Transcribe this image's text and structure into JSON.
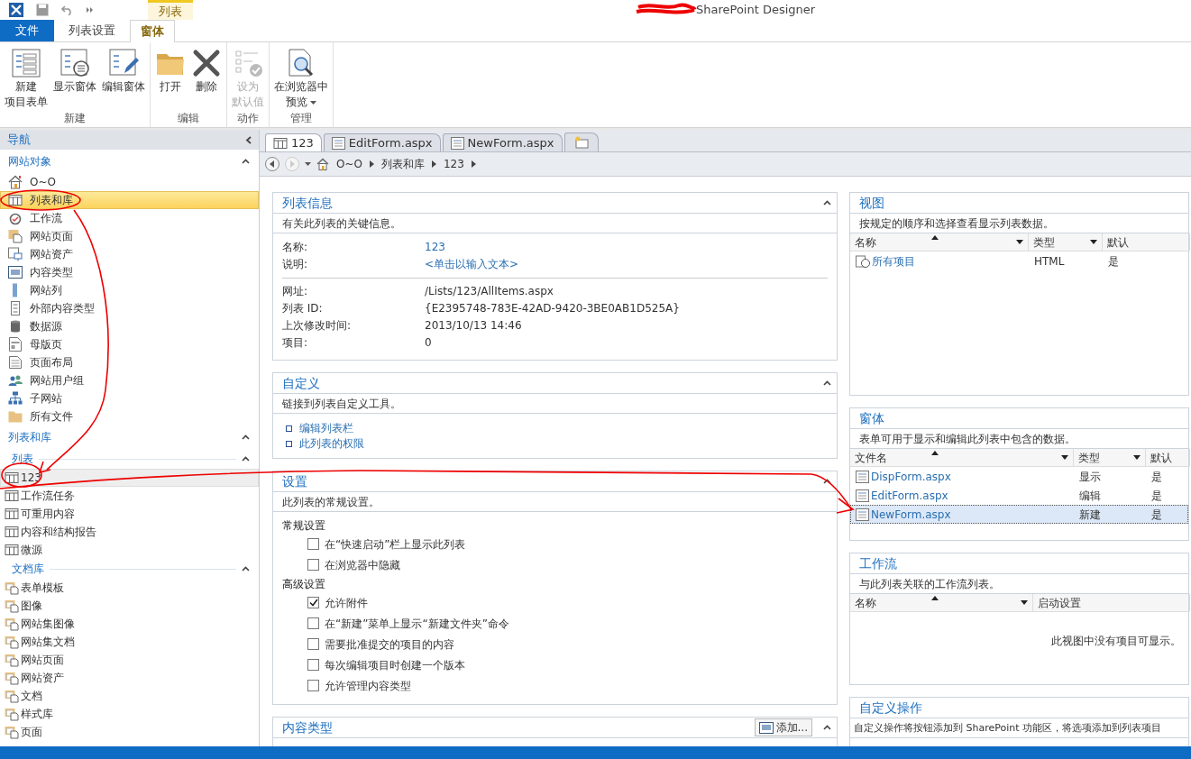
{
  "window": {
    "title": "SharePoint Designer"
  },
  "ribbon": {
    "contextual_label": "列表",
    "tabs": [
      {
        "label": "文件",
        "kind": "file",
        "selected": false
      },
      {
        "label": "列表设置",
        "kind": "normal",
        "selected": false
      },
      {
        "label": "窗体",
        "kind": "contextual",
        "selected": true
      }
    ],
    "groups": [
      {
        "label": "新建",
        "buttons": [
          {
            "lines": [
              "新建",
              "项目表单"
            ],
            "disabled": false
          },
          {
            "lines": [
              "显示窗体"
            ],
            "disabled": false
          },
          {
            "lines": [
              "编辑窗体"
            ],
            "disabled": false
          }
        ]
      },
      {
        "label": "编辑",
        "buttons": [
          {
            "lines": [
              "打开"
            ],
            "disabled": false
          },
          {
            "lines": [
              "删除"
            ],
            "disabled": false
          }
        ]
      },
      {
        "label": "动作",
        "buttons": [
          {
            "lines": [
              "设为",
              "默认值"
            ],
            "disabled": true
          }
        ]
      },
      {
        "label": "管理",
        "buttons": [
          {
            "lines": [
              "在浏览器中",
              "预览"
            ],
            "disabled": false,
            "dropdown": true
          }
        ]
      }
    ]
  },
  "navigation": {
    "title": "导航",
    "site_objects": {
      "title": "网站对象",
      "expanded": true,
      "items": [
        {
          "label": "O~O",
          "selected": false
        },
        {
          "label": "列表和库",
          "selected": true
        },
        {
          "label": "工作流",
          "selected": false
        },
        {
          "label": "网站页面",
          "selected": false
        },
        {
          "label": "网站资产",
          "selected": false
        },
        {
          "label": "内容类型",
          "selected": false
        },
        {
          "label": "网站列",
          "selected": false
        },
        {
          "label": "外部内容类型",
          "selected": false
        },
        {
          "label": "数据源",
          "selected": false
        },
        {
          "label": "母版页",
          "selected": false
        },
        {
          "label": "页面布局",
          "selected": false
        },
        {
          "label": "网站用户组",
          "selected": false
        },
        {
          "label": "子网站",
          "selected": false
        },
        {
          "label": "所有文件",
          "selected": false
        }
      ]
    },
    "lists_and_libraries": {
      "title": "列表和库",
      "expanded": true,
      "groups": [
        {
          "title": "列表",
          "kind": "list",
          "expanded": true,
          "items": [
            {
              "label": "123",
              "selected": true
            },
            {
              "label": "工作流任务",
              "selected": false
            },
            {
              "label": "可重用内容",
              "selected": false
            },
            {
              "label": "内容和结构报告",
              "selected": false
            },
            {
              "label": "微源",
              "selected": false
            }
          ]
        },
        {
          "title": "文档库",
          "kind": "library",
          "expanded": true,
          "items": [
            {
              "label": "表单模板",
              "selected": false
            },
            {
              "label": "图像",
              "selected": false
            },
            {
              "label": "网站集图像",
              "selected": false
            },
            {
              "label": "网站集文档",
              "selected": false
            },
            {
              "label": "网站页面",
              "selected": false
            },
            {
              "label": "网站资产",
              "selected": false
            },
            {
              "label": "文档",
              "selected": false
            },
            {
              "label": "样式库",
              "selected": false
            },
            {
              "label": "页面",
              "selected": false
            }
          ]
        }
      ]
    }
  },
  "document_tabs": [
    {
      "label": "123",
      "kind": "list",
      "selected": true
    },
    {
      "label": "EditForm.aspx",
      "kind": "form",
      "selected": false
    },
    {
      "label": "NewForm.aspx",
      "kind": "form",
      "selected": false
    }
  ],
  "breadcrumb": [
    "O~O",
    "列表和库",
    "123"
  ],
  "list_info": {
    "title": "列表信息",
    "expanded": true,
    "description": "有关此列表的关键信息。",
    "field_groups": [
      [
        {
          "label": "名称:",
          "value": "123",
          "kind": "link"
        },
        {
          "label": "说明:",
          "value": "<单击以输入文本>",
          "kind": "link"
        }
      ],
      [
        {
          "label": "网址:",
          "value": "/Lists/123/AllItems.aspx",
          "kind": "plain"
        },
        {
          "label": "列表 ID:",
          "value": "{E2395748-783E-42AD-9420-3BE0AB1D525A}",
          "kind": "plain"
        },
        {
          "label": "上次修改时间:",
          "value": "2013/10/13 14:46",
          "kind": "plain"
        },
        {
          "label": "项目:",
          "value": "0",
          "kind": "plain"
        }
      ]
    ]
  },
  "customization": {
    "title": "自定义",
    "expanded": true,
    "description": "链接到列表自定义工具。",
    "links": [
      "编辑列表栏",
      "此列表的权限"
    ]
  },
  "settings": {
    "title": "设置",
    "expanded": true,
    "description": "此列表的常规设置。",
    "groups": [
      {
        "title": "常规设置",
        "options": [
          {
            "label": "在“快速启动”栏上显示此列表",
            "checked": false
          },
          {
            "label": "在浏览器中隐藏",
            "checked": false
          }
        ]
      },
      {
        "title": "高级设置",
        "options": [
          {
            "label": "允许附件",
            "checked": true
          },
          {
            "label": "在“新建”菜单上显示“新建文件夹”命令",
            "checked": false
          },
          {
            "label": "需要批准提交的项目的内容",
            "checked": false
          },
          {
            "label": "每次编辑项目时创建一个版本",
            "checked": false
          },
          {
            "label": "允许管理内容类型",
            "checked": false
          }
        ]
      }
    ]
  },
  "content_types": {
    "title": "内容类型",
    "expanded": true,
    "add_button": "添加..."
  },
  "views": {
    "title": "视图",
    "description": "按规定的顺序和选择查看显示列表数据。",
    "columns": [
      {
        "label": "名称",
        "sorted": true,
        "filter": true
      },
      {
        "label": "类型",
        "sorted": false,
        "filter": true
      },
      {
        "label": "默认",
        "sorted": false,
        "filter": false
      }
    ],
    "rows": [
      {
        "cells": [
          "所有项目",
          "HTML",
          "是"
        ],
        "selected": false
      }
    ]
  },
  "forms": {
    "title": "窗体",
    "description": "表单可用于显示和编辑此列表中包含的数据。",
    "columns": [
      {
        "label": "文件名",
        "sorted": true,
        "filter": true
      },
      {
        "label": "类型",
        "sorted": false,
        "filter": true
      },
      {
        "label": "默认",
        "sorted": false,
        "filter": false
      }
    ],
    "rows": [
      {
        "cells": [
          "DispForm.aspx",
          "显示",
          "是"
        ],
        "selected": false
      },
      {
        "cells": [
          "EditForm.aspx",
          "编辑",
          "是"
        ],
        "selected": false
      },
      {
        "cells": [
          "NewForm.aspx",
          "新建",
          "是"
        ],
        "selected": true
      }
    ]
  },
  "workflows": {
    "title": "工作流",
    "description": "与此列表关联的工作流列表。",
    "columns": [
      {
        "label": "名称",
        "sorted": true,
        "filter": true
      },
      {
        "label": "启动设置",
        "sorted": false,
        "filter": false
      }
    ],
    "empty_message": "此视图中没有项目可显示。"
  },
  "custom_actions": {
    "title": "自定义操作",
    "description": "自定义操作将按钮添加到 SharePoint 功能区，将选项添加到列表项目"
  }
}
